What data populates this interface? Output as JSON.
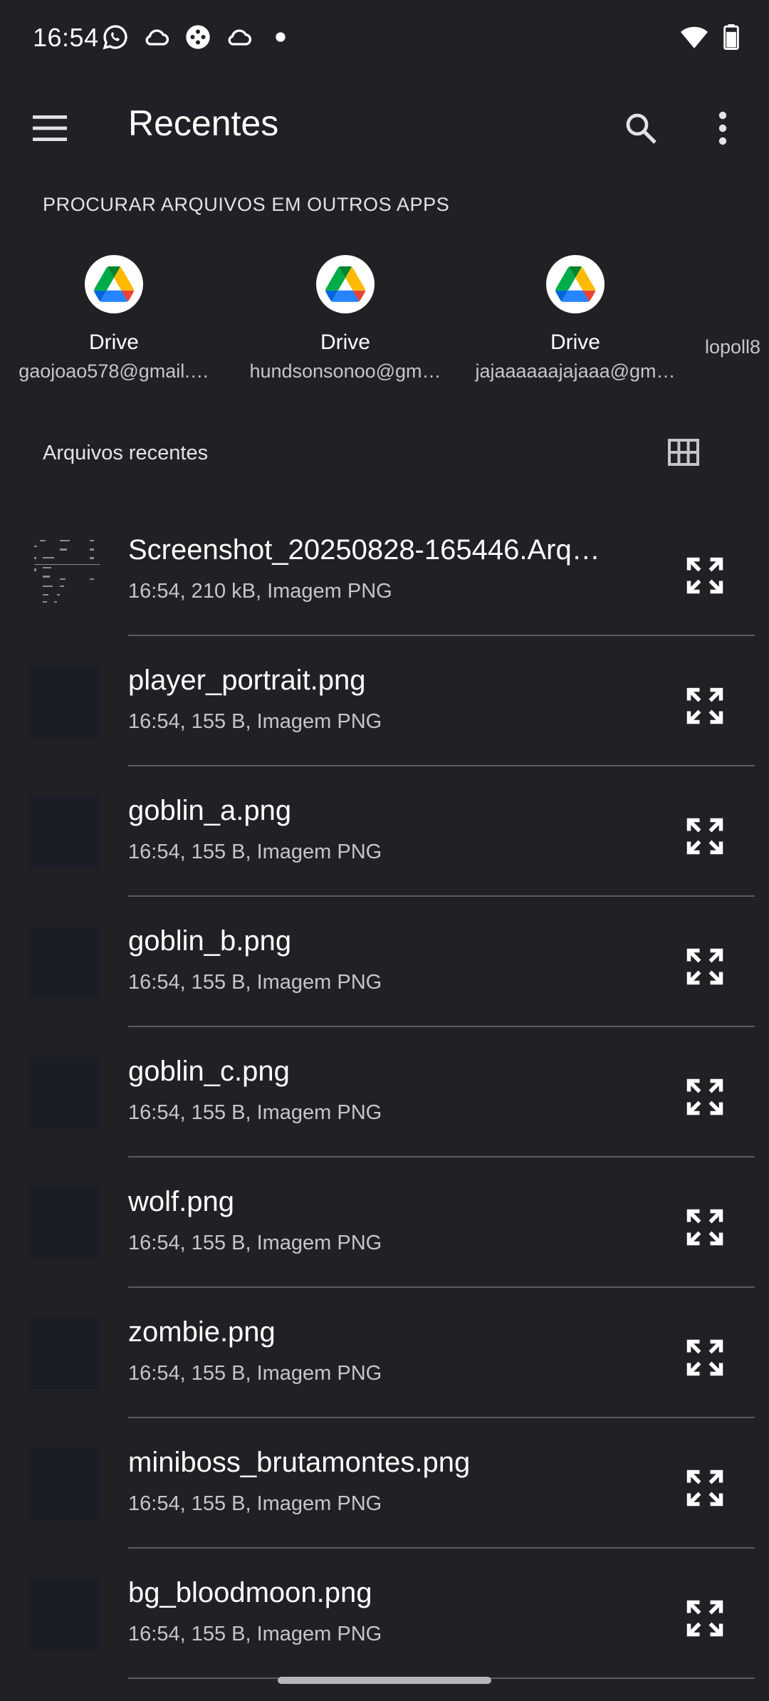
{
  "status_bar": {
    "time": "16:54",
    "icons": [
      "whatsapp-icon",
      "cloud-icon",
      "gamepad-icon",
      "cloud-icon",
      "dot-icon",
      "wifi-icon",
      "battery-icon"
    ]
  },
  "app_bar": {
    "title": "Recentes",
    "icons": [
      "menu-icon",
      "search-icon",
      "more-vert-icon"
    ]
  },
  "other_apps": {
    "header": "PROCURAR ARQUIVOS EM OUTROS APPS",
    "items": [
      {
        "name": "Drive",
        "account": "gaojoao578@gmail.…",
        "icon": "google-drive-icon"
      },
      {
        "name": "Drive",
        "account": "hundsonsonoo@gm…",
        "icon": "google-drive-icon"
      },
      {
        "name": "Drive",
        "account": "jajaaaaaajajaaa@gm…",
        "icon": "google-drive-icon"
      },
      {
        "name": "",
        "account": "lopoll8",
        "icon": ""
      }
    ]
  },
  "recent": {
    "header": "Arquivos recentes",
    "view_icon": "grid-view-icon",
    "files": [
      {
        "name": "Screenshot_20250828-165446.Arq…",
        "meta": "16:54, 210 kB, Imagem PNG"
      },
      {
        "name": "player_portrait.png",
        "meta": "16:54, 155 B, Imagem PNG"
      },
      {
        "name": "goblin_a.png",
        "meta": "16:54, 155 B, Imagem PNG"
      },
      {
        "name": "goblin_b.png",
        "meta": "16:54, 155 B, Imagem PNG"
      },
      {
        "name": "goblin_c.png",
        "meta": "16:54, 155 B, Imagem PNG"
      },
      {
        "name": "wolf.png",
        "meta": "16:54, 155 B, Imagem PNG"
      },
      {
        "name": "zombie.png",
        "meta": "16:54, 155 B, Imagem PNG"
      },
      {
        "name": "miniboss_brutamontes.png",
        "meta": "16:54, 155 B, Imagem PNG"
      },
      {
        "name": "bg_bloodmoon.png",
        "meta": "16:54, 155 B, Imagem PNG"
      }
    ]
  },
  "colors": {
    "background": "#212125",
    "text_primary": "#ffffff",
    "text_secondary": "#c8c4c9",
    "divider": "#5b5b60"
  }
}
